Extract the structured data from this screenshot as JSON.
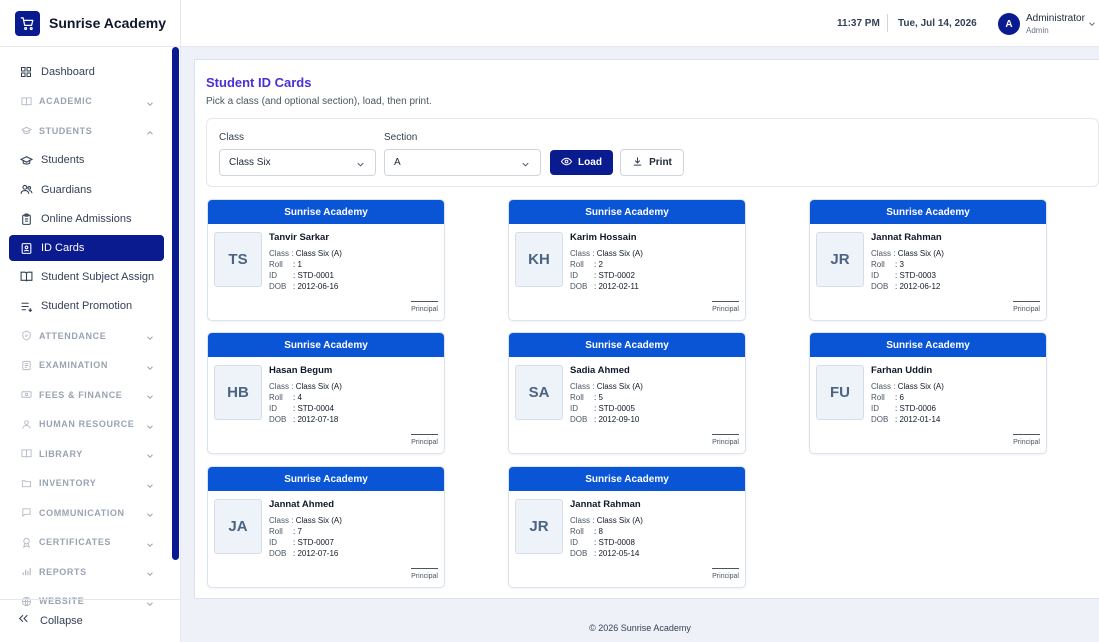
{
  "brand": {
    "name": "Sunrise Academy",
    "icon": "cart-icon"
  },
  "header": {
    "time": "11:37 PM",
    "date": "Tue, Jul 14, 2026",
    "user_initial": "A",
    "user_name": "Administrator",
    "user_role": "Admin"
  },
  "sidebar": {
    "items": [
      {
        "label": "Dashboard",
        "icon": "grid-icon",
        "type": "link"
      },
      {
        "label": "ACADEMIC",
        "icon": "book-icon",
        "type": "section",
        "expanded": false
      },
      {
        "label": "STUDENTS",
        "icon": "cap-icon",
        "type": "section",
        "expanded": true
      },
      {
        "label": "Students",
        "icon": "cap-icon",
        "type": "sub"
      },
      {
        "label": "Guardians",
        "icon": "users-icon",
        "type": "sub"
      },
      {
        "label": "Online Admissions",
        "icon": "clipboard-icon",
        "type": "sub"
      },
      {
        "label": "ID Cards",
        "icon": "id-card-icon",
        "type": "sub",
        "active": true
      },
      {
        "label": "Student Subject Assign",
        "icon": "book-icon",
        "type": "sub"
      },
      {
        "label": "Student Promotion",
        "icon": "list-icon",
        "type": "sub"
      },
      {
        "label": "ATTENDANCE",
        "icon": "check-shield-icon",
        "type": "section",
        "expanded": false
      },
      {
        "label": "EXAMINATION",
        "icon": "exam-icon",
        "type": "section",
        "expanded": false
      },
      {
        "label": "FEES & FINANCE",
        "icon": "money-icon",
        "type": "section",
        "expanded": false
      },
      {
        "label": "HUMAN RESOURCE",
        "icon": "person-icon",
        "type": "section",
        "expanded": false
      },
      {
        "label": "LIBRARY",
        "icon": "book-icon",
        "type": "section",
        "expanded": false
      },
      {
        "label": "INVENTORY",
        "icon": "folder-icon",
        "type": "section",
        "expanded": false
      },
      {
        "label": "COMMUNICATION",
        "icon": "chat-icon",
        "type": "section",
        "expanded": false
      },
      {
        "label": "CERTIFICATES",
        "icon": "badge-icon",
        "type": "section",
        "expanded": false
      },
      {
        "label": "REPORTS",
        "icon": "bar-chart-icon",
        "type": "section",
        "expanded": false
      },
      {
        "label": "WEBSITE",
        "icon": "globe-icon",
        "type": "section",
        "expanded": false
      }
    ],
    "collapse_label": "Collapse"
  },
  "page": {
    "title": "Student ID Cards",
    "subtitle": "Pick a class (and optional section), load, then print.",
    "class_label": "Class",
    "class_value": "Class Six",
    "section_label": "Section",
    "section_value": "A",
    "load_label": "Load",
    "print_label": "Print"
  },
  "card_labels": {
    "school": "Sunrise Academy",
    "class_key": "Class :",
    "roll_key": "Roll",
    "id_key": "ID",
    "dob_key": "DOB",
    "signature": "Principal"
  },
  "cards": [
    {
      "initials": "TS",
      "name": "Tanvir Sarkar",
      "class": "Class Six (A)",
      "roll": ": 1",
      "id": ": STD-0001",
      "dob": ": 2012-06-16"
    },
    {
      "initials": "KH",
      "name": "Karim Hossain",
      "class": "Class Six (A)",
      "roll": ": 2",
      "id": ": STD-0002",
      "dob": ": 2012-02-11"
    },
    {
      "initials": "JR",
      "name": "Jannat Rahman",
      "class": "Class Six (A)",
      "roll": ": 3",
      "id": ": STD-0003",
      "dob": ": 2012-06-12"
    },
    {
      "initials": "HB",
      "name": "Hasan Begum",
      "class": "Class Six (A)",
      "roll": ": 4",
      "id": ": STD-0004",
      "dob": ": 2012-07-18"
    },
    {
      "initials": "SA",
      "name": "Sadia Ahmed",
      "class": "Class Six (A)",
      "roll": ": 5",
      "id": ": STD-0005",
      "dob": ": 2012-09-10"
    },
    {
      "initials": "FU",
      "name": "Farhan Uddin",
      "class": "Class Six (A)",
      "roll": ": 6",
      "id": ": STD-0006",
      "dob": ": 2012-01-14"
    },
    {
      "initials": "JA",
      "name": "Jannat Ahmed",
      "class": "Class Six (A)",
      "roll": ": 7",
      "id": ": STD-0007",
      "dob": ": 2012-07-16"
    },
    {
      "initials": "JR",
      "name": "Jannat Rahman",
      "class": "Class Six (A)",
      "roll": ": 8",
      "id": ": STD-0008",
      "dob": ": 2012-05-14"
    }
  ],
  "footer": "© 2026 Sunrise Academy",
  "colors": {
    "primary": "#0a1b8f",
    "card_header": "#0a55d6",
    "title": "#4a2fd8"
  }
}
